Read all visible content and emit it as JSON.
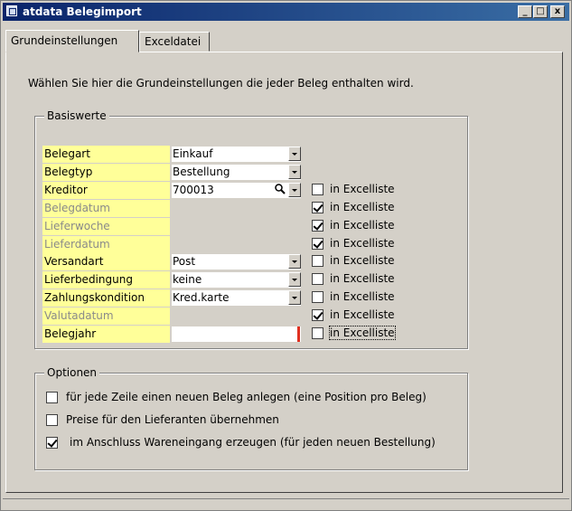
{
  "window": {
    "title": "atdata Belegimport",
    "app_icon": "window-app-icon",
    "minimize": "_",
    "maximize": "□",
    "close": "x"
  },
  "tabs": [
    {
      "label": "Grundeinstellungen",
      "active": true
    },
    {
      "label": "Exceldatei",
      "active": false
    }
  ],
  "intro_text": "Wählen Sie hier die Grundeinstellungen die jeder Beleg enthalten wird.",
  "basiswerte": {
    "legend": "Basiswerte",
    "excel_label": "in Excelliste",
    "rows": [
      {
        "label": "Belegart",
        "value": "Einkauf",
        "enabled": true,
        "control": "dropdown"
      },
      {
        "label": "Belegtyp",
        "value": "Bestellung",
        "enabled": true,
        "control": "dropdown"
      },
      {
        "label": "Kreditor",
        "value": "700013",
        "enabled": true,
        "control": "lookup",
        "excel": false
      },
      {
        "label": "Belegdatum",
        "value": "",
        "enabled": false,
        "control": "none",
        "excel": true
      },
      {
        "label": "Lieferwoche",
        "value": "",
        "enabled": false,
        "control": "none",
        "excel": true
      },
      {
        "label": "Lieferdatum",
        "value": "",
        "enabled": false,
        "control": "none",
        "excel": true
      },
      {
        "label": "Versandart",
        "value": "Post",
        "enabled": true,
        "control": "dropdown",
        "excel": false
      },
      {
        "label": "Lieferbedingung",
        "value": "keine",
        "enabled": true,
        "control": "dropdown",
        "excel": false
      },
      {
        "label": "Zahlungskondition",
        "value": "Kred.karte",
        "enabled": true,
        "control": "dropdown",
        "excel": false
      },
      {
        "label": "Valutadatum",
        "value": "",
        "enabled": false,
        "control": "none",
        "excel": true
      },
      {
        "label": "Belegjahr",
        "value": "",
        "enabled": true,
        "control": "text",
        "excel": false
      }
    ]
  },
  "optionen": {
    "legend": "Optionen",
    "items": [
      {
        "label": "für jede Zeile einen neuen Beleg anlegen (eine Position pro Beleg)",
        "checked": false
      },
      {
        "label": "Preise für den Lieferanten übernehmen",
        "checked": false
      },
      {
        "label": "im Anschluss Wareneingang erzeugen (für jeden neuen Bestellung)",
        "checked": true
      }
    ]
  },
  "colors": {
    "titlebar_start": "#0a246a",
    "titlebar_end": "#3a6ea5",
    "label_bg": "#ffff99",
    "dialog_bg": "#d4d0c8",
    "required_marker": "#e03020"
  }
}
